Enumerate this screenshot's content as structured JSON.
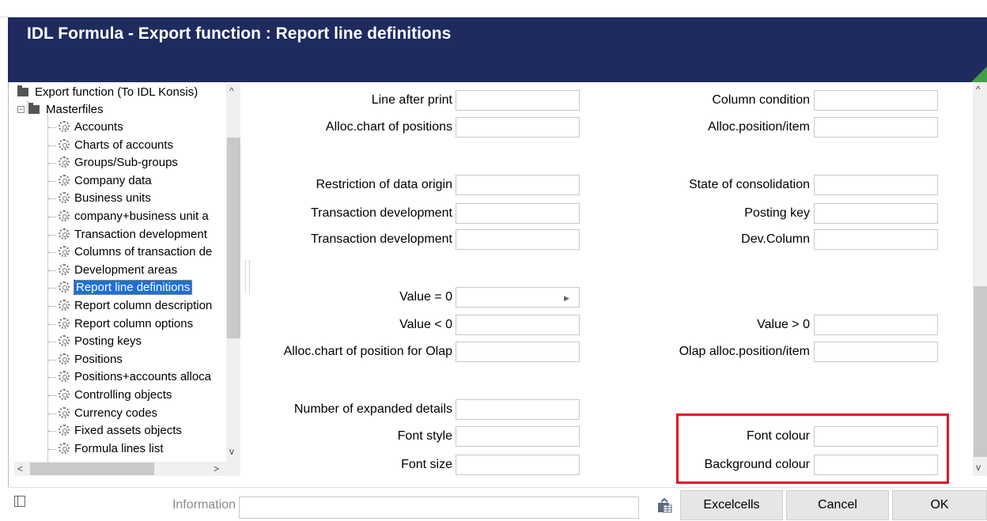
{
  "window": {
    "title": "IDL Formula - Export function : Report line definitions",
    "controls": {
      "minimize": "–",
      "maximize": "▫",
      "close": "×"
    }
  },
  "tree": {
    "root": "Export function (To IDL Konsis)",
    "group": "Masterfiles",
    "items": [
      "Accounts",
      "Charts of accounts",
      "Groups/Sub-groups",
      "Company data",
      "Business units",
      "company+business unit a",
      "Transaction development",
      "Columns of transaction de",
      "Development areas",
      "Report line definitions",
      "Report column description",
      "Report column options",
      "Posting keys",
      "Positions",
      "Positions+accounts alloca",
      "Controlling objects",
      "Currency codes",
      "Fixed assets objects",
      "Formula lines list"
    ],
    "selected_index": 9
  },
  "form": {
    "left": [
      {
        "label": "Line after print",
        "value": ""
      },
      {
        "label": "Alloc.chart of positions",
        "value": ""
      },
      {
        "label": "Restriction of data origin",
        "value": ""
      },
      {
        "label": "Transaction development",
        "value": ""
      },
      {
        "label": "Transaction development",
        "value": ""
      },
      {
        "label": "Value = 0",
        "value": ""
      },
      {
        "label": "Value < 0",
        "value": ""
      },
      {
        "label": "Alloc.chart of position for Olap",
        "value": ""
      },
      {
        "label": "Number of expanded details",
        "value": ""
      },
      {
        "label": "Font style",
        "value": ""
      },
      {
        "label": "Font size",
        "value": ""
      }
    ],
    "right": [
      {
        "label": "Column condition",
        "value": ""
      },
      {
        "label": "Alloc.position/item",
        "value": ""
      },
      {
        "label": "State of consolidation",
        "value": ""
      },
      {
        "label": "Posting key",
        "value": ""
      },
      {
        "label": "Dev.Column",
        "value": ""
      },
      {
        "label": "Value > 0",
        "value": ""
      },
      {
        "label": "Olap alloc.position/item",
        "value": ""
      },
      {
        "label": "Font colour",
        "value": ""
      },
      {
        "label": "Background colour",
        "value": ""
      }
    ]
  },
  "footer": {
    "info_label": "Information",
    "info_value": "",
    "buttons": {
      "excelcells": "Excelcells",
      "cancel": "Cancel",
      "ok": "OK"
    }
  },
  "colors": {
    "titlebar": "#1f2b5e",
    "selection": "#1e6fd9",
    "highlight": "#e0142a",
    "corner_accent": "#43a047"
  }
}
